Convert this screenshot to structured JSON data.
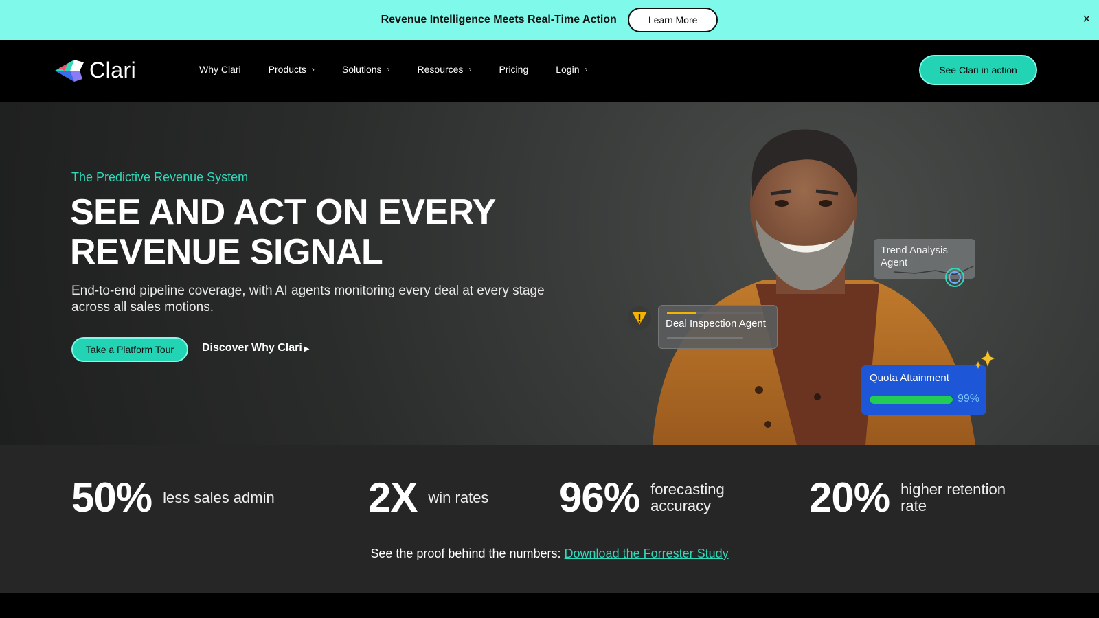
{
  "announcement": {
    "text": "Revenue Intelligence Meets Real-Time Action",
    "button": "Learn More",
    "close": "×"
  },
  "nav": {
    "logo_text": "Clari",
    "items": [
      {
        "label": "Why Clari",
        "has_menu": false
      },
      {
        "label": "Products",
        "has_menu": true
      },
      {
        "label": "Solutions",
        "has_menu": true
      },
      {
        "label": "Resources",
        "has_menu": true
      },
      {
        "label": "Pricing",
        "has_menu": false
      },
      {
        "label": "Login",
        "has_menu": true
      }
    ],
    "cta": "See Clari in action"
  },
  "hero": {
    "eyebrow": "The Predictive Revenue System",
    "headline_line1": "SEE AND ACT ON EVERY",
    "headline_line2": "REVENUE SIGNAL",
    "subheadline": "End-to-end pipeline coverage, with AI agents monitoring every deal at every stage across all sales motions.",
    "primary_button": "Take a Platform Tour",
    "secondary_link": "Discover Why Clari"
  },
  "overlay_cards": {
    "trend": "Trend Analysis Agent",
    "deal": "Deal Inspection Agent",
    "quota_title": "Quota Attainment",
    "quota_value": "99%",
    "quota_fraction": 0.99
  },
  "stats": [
    {
      "number": "50%",
      "label": "less sales admin"
    },
    {
      "number": "2X",
      "label": "win rates"
    },
    {
      "number": "96%",
      "label": "forecasting accuracy"
    },
    {
      "number": "20%",
      "label": "higher retention rate"
    }
  ],
  "proof": {
    "text": "See the proof behind the numbers: ",
    "link": "Download the Forrester Study"
  },
  "colors": {
    "accent": "#22d3b4",
    "announce_bg": "#7ff9ea",
    "quota_card": "#1d56d6"
  }
}
